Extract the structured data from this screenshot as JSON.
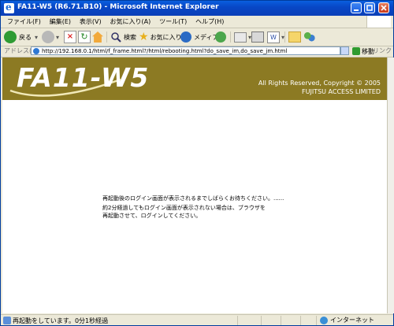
{
  "window": {
    "title": "FA11-W5 (R6.71.B10) - Microsoft Internet Explorer"
  },
  "menu": {
    "items": [
      "ファイル(F)",
      "編集(E)",
      "表示(V)",
      "お気に入り(A)",
      "ツール(T)",
      "ヘルプ(H)"
    ]
  },
  "toolbar": {
    "back_label": "戻る",
    "search_label": "検索",
    "favorites_label": "お気に入り",
    "media_label": "メディア"
  },
  "address": {
    "label": "アドレス(D)",
    "url": "http://192.168.0.1/html/f_frame.html?/html/rebooting.html?do_save_im,do_save_jm.html",
    "go_label": "移動",
    "links_label": "リンク"
  },
  "banner": {
    "logo": "FA11-W5",
    "copyright_line1": "All Rights Reserved, Copyright © 2005",
    "copyright_line2": "FUJITSU ACCESS LIMITED"
  },
  "message": {
    "line1": "再起動後のログイン画面が表示されるまでしばらくお待ちください。......",
    "line2": "約2分経過してもログイン画面が表示されない場合は、ブラウザを",
    "line3": "再起動させて、ログインしてください。"
  },
  "status": {
    "text": "再起動をしています。0分1秒経過",
    "zone": "インターネット"
  },
  "colors": {
    "title_bar": "#0a4fd0",
    "banner": "#8c7a23"
  }
}
